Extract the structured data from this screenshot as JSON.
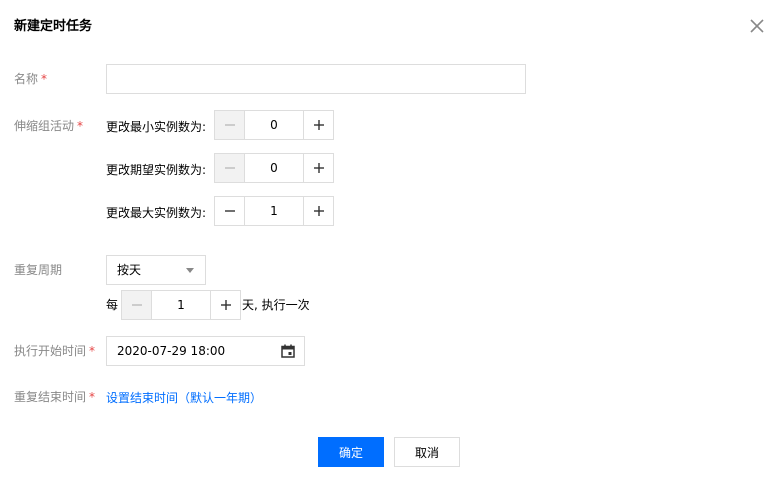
{
  "dialog": {
    "title": "新建定时任务",
    "close_icon": "close-icon"
  },
  "form": {
    "name": {
      "label": "名称",
      "required_mark": "*",
      "value": "",
      "placeholder": ""
    },
    "scaling": {
      "label": "伸缩组活动",
      "required_mark": "*",
      "min": {
        "label": "更改最小实例数为:",
        "value": "0",
        "minus_disabled": true
      },
      "desired": {
        "label": "更改期望实例数为:",
        "value": "0",
        "minus_disabled": true
      },
      "max": {
        "label": "更改最大实例数为:",
        "value": "1",
        "minus_disabled": false
      }
    },
    "repeat": {
      "label": "重复周期",
      "selected": "按天",
      "every_prefix": "每",
      "every_value": "1",
      "every_suffix": "天, 执行一次"
    },
    "start_time": {
      "label": "执行开始时间",
      "required_mark": "*",
      "value": "2020-07-29 18:00",
      "icon": "calendar-icon"
    },
    "end_time": {
      "label": "重复结束时间",
      "required_mark": "*",
      "link_text": "设置结束时间（默认一年期）"
    }
  },
  "footer": {
    "confirm_label": "确定",
    "cancel_label": "取消"
  },
  "colors": {
    "primary": "#006eff",
    "required": "#e54545",
    "label": "#888888",
    "border": "#dddddd"
  }
}
